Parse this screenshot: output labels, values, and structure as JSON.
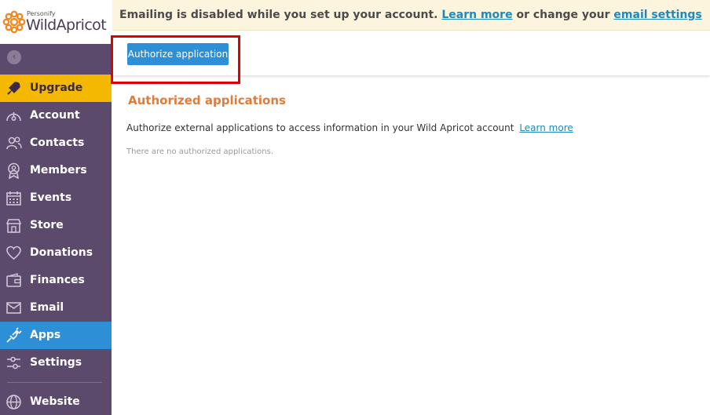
{
  "logo": {
    "small": "Personify",
    "big": "WildApricot"
  },
  "sidebar": {
    "items": [
      {
        "label": "Upgrade"
      },
      {
        "label": "Account"
      },
      {
        "label": "Contacts"
      },
      {
        "label": "Members"
      },
      {
        "label": "Events"
      },
      {
        "label": "Store"
      },
      {
        "label": "Donations"
      },
      {
        "label": "Finances"
      },
      {
        "label": "Email"
      },
      {
        "label": "Apps"
      },
      {
        "label": "Settings"
      },
      {
        "label": "Website"
      }
    ],
    "active": "Apps"
  },
  "banner": {
    "text_before": "Emailing is disabled while you set up your account.",
    "learn_more": "Learn more",
    "text_mid": "or change your",
    "email_settings": "email settings"
  },
  "toolbar": {
    "authorize_label": "Authorize application"
  },
  "main": {
    "title": "Authorized applications",
    "description": "Authorize external applications to access information in your Wild Apricot account",
    "learn_more": "Learn more",
    "empty": "There are no authorized applications."
  },
  "colors": {
    "sidebar": "#5b4a6b",
    "upgrade": "#f5b800",
    "active": "#2d8fd5",
    "accent_title": "#e07b39",
    "link": "#1f88bd",
    "highlight": "#e10000"
  }
}
